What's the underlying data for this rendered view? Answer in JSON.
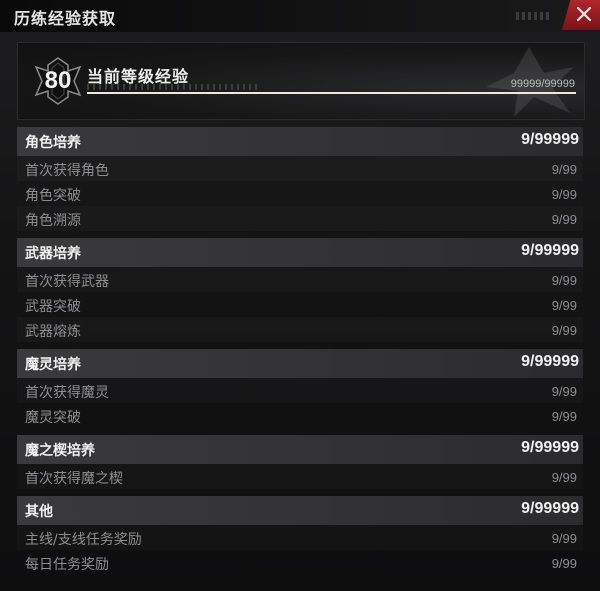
{
  "window": {
    "title": "历练经验获取",
    "close_icon": "close-icon"
  },
  "level": {
    "value": "80",
    "label": "当前等级经验",
    "exp_text": "99999/99999",
    "exp_progress": 1.0
  },
  "sections": [
    {
      "title": "角色培养",
      "value": "9/99999",
      "rows": [
        {
          "label": "首次获得角色",
          "value": "9/99"
        },
        {
          "label": "角色突破",
          "value": "9/99"
        },
        {
          "label": "角色溯源",
          "value": "9/99"
        }
      ]
    },
    {
      "title": "武器培养",
      "value": "9/99999",
      "rows": [
        {
          "label": "首次获得武器",
          "value": "9/99"
        },
        {
          "label": "武器突破",
          "value": "9/99"
        },
        {
          "label": "武器熔炼",
          "value": "9/99"
        }
      ]
    },
    {
      "title": "魔灵培养",
      "value": "9/99999",
      "rows": [
        {
          "label": "首次获得魔灵",
          "value": "9/99"
        },
        {
          "label": "魔灵突破",
          "value": "9/99"
        }
      ]
    },
    {
      "title": "魔之楔培养",
      "value": "9/99999",
      "rows": [
        {
          "label": "首次获得魔之楔",
          "value": "9/99"
        }
      ]
    },
    {
      "title": "其他",
      "value": "9/99999",
      "rows": [
        {
          "label": "主线/支线任务奖励",
          "value": "9/99"
        },
        {
          "label": "每日任务奖励",
          "value": "9/99"
        }
      ]
    }
  ],
  "colors": {
    "accent_red": "#b0262c",
    "progress_fill": "#ece8dc"
  }
}
